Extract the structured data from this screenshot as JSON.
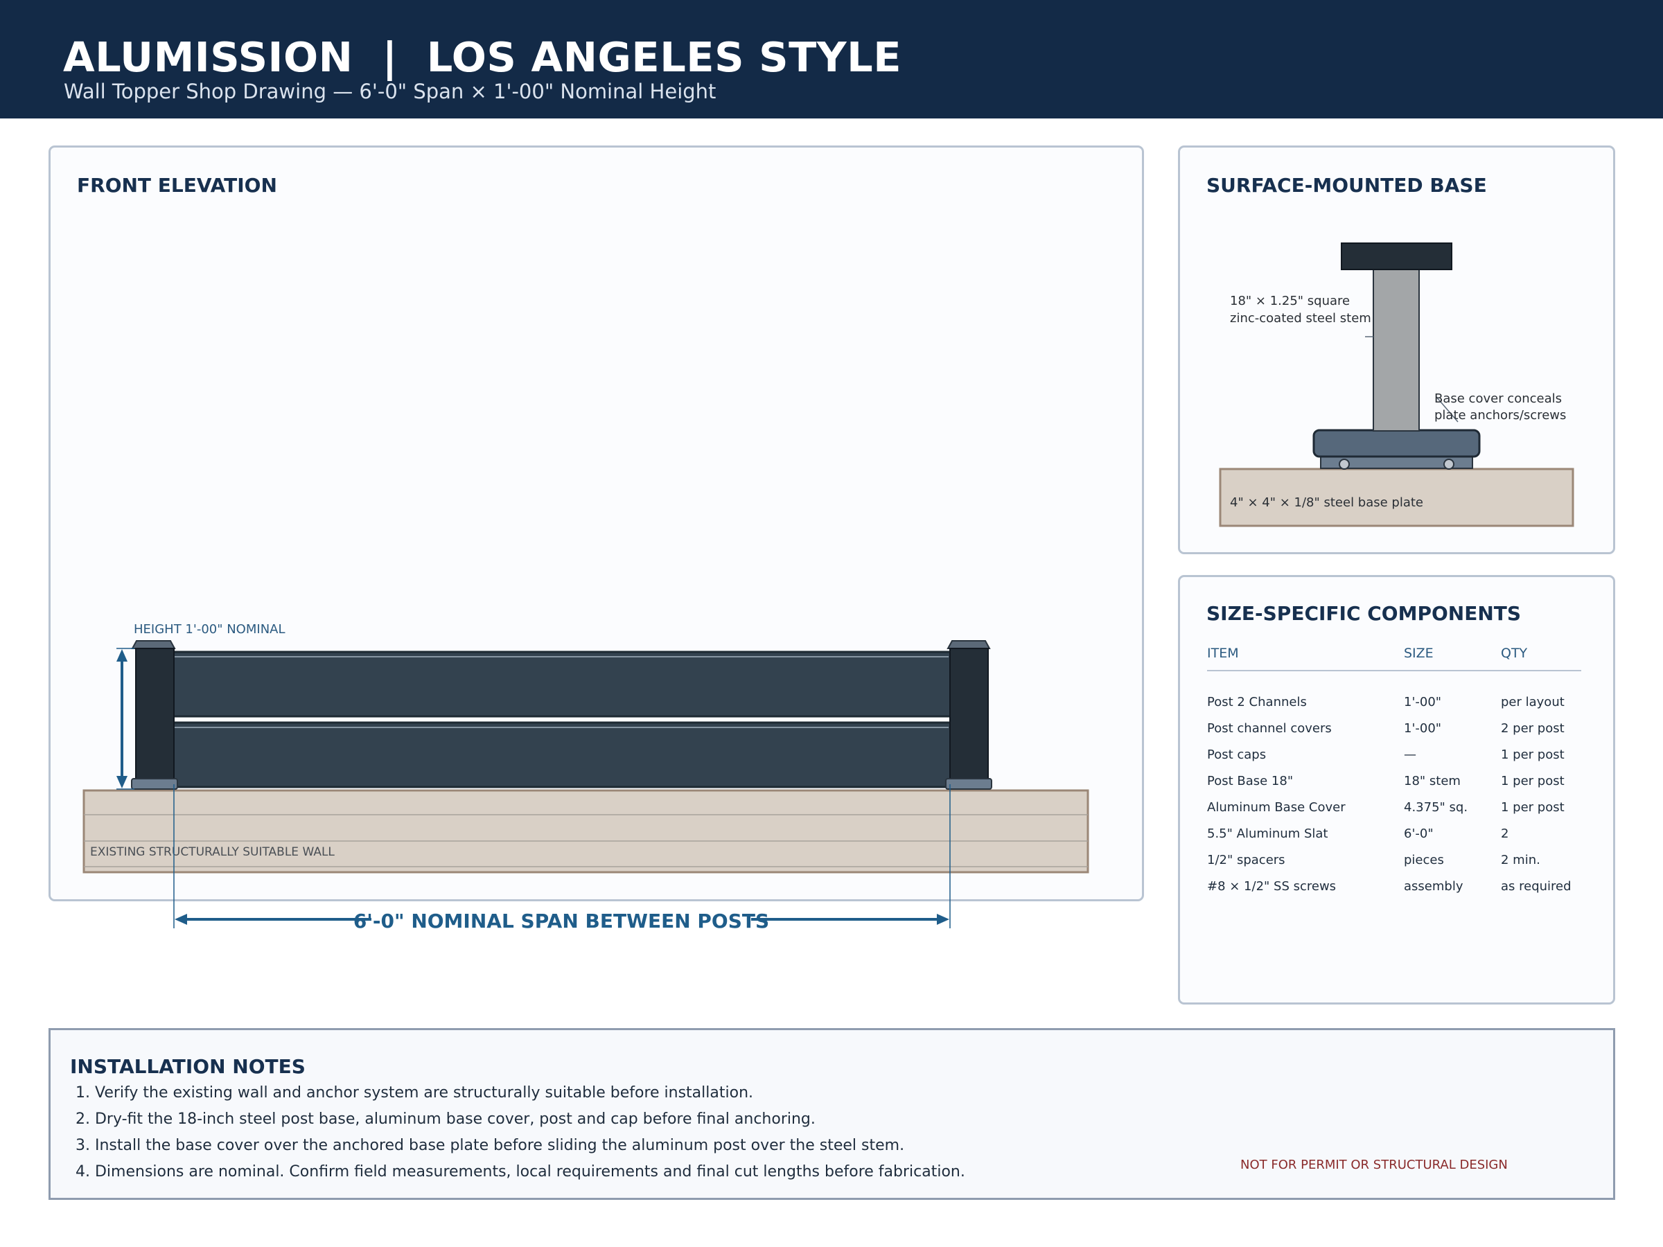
{
  "header": {
    "title": "ALUMISSION  |  LOS ANGELES STYLE",
    "subtitle": "Wall Topper Shop Drawing — 6'-0\" Span × 1'-00\" Nominal Height"
  },
  "elevation": {
    "title": "FRONT ELEVATION",
    "height_label": "HEIGHT 1'-00\" NOMINAL",
    "wall_label": "EXISTING STRUCTURALLY SUITABLE WALL",
    "span_label": "6'-0\" NOMINAL SPAN BETWEEN POSTS"
  },
  "base": {
    "title": "SURFACE-MOUNTED BASE",
    "stem_label_line1": "18\" × 1.25\" square",
    "stem_label_line2": "zinc-coated steel stem",
    "cover_label_line1": "Base cover conceals",
    "cover_label_line2": "plate anchors/screws",
    "plate_label": "4\" × 4\" × 1/8\" steel base plate"
  },
  "components": {
    "title": "SIZE-SPECIFIC COMPONENTS",
    "headers": {
      "item": "ITEM",
      "size": "SIZE",
      "qty": "QTY"
    },
    "rows": [
      {
        "item": "Post 2 Channels",
        "size": "1'-00\"",
        "qty": "per layout"
      },
      {
        "item": "Post channel covers",
        "size": "1'-00\"",
        "qty": "2 per post"
      },
      {
        "item": "Post caps",
        "size": "—",
        "qty": "1 per post"
      },
      {
        "item": "Post Base 18\"",
        "size": "18\" stem",
        "qty": "1 per post"
      },
      {
        "item": "Aluminum Base Cover",
        "size": "4.375\" sq.",
        "qty": "1 per post"
      },
      {
        "item": "5.5\" Aluminum Slat",
        "size": "6'-0\"",
        "qty": "2"
      },
      {
        "item": "1/2\" spacers",
        "size": "pieces",
        "qty": "2 min."
      },
      {
        "item": "#8 × 1/2\" SS screws",
        "size": "assembly",
        "qty": "as required"
      }
    ]
  },
  "notes": {
    "title": "INSTALLATION NOTES",
    "items": [
      "1. Verify the existing wall and anchor system are structurally suitable before installation.",
      "2. Dry-fit the 18-inch steel post base, aluminum base cover, post and cap before final anchoring.",
      "3. Install the base cover over the anchored base plate before sliding the aluminum post over the steel stem.",
      "4. Dimensions are nominal. Confirm field measurements, local requirements and final cut lengths before fabrication."
    ],
    "disclaimer": "NOT FOR PERMIT OR STRUCTURAL DESIGN"
  },
  "colors": {
    "header_bg": "#132a47",
    "slat": "#33424f",
    "post": "#242e37",
    "wall": "#d9d0c6",
    "dimension": "#1f5d8a",
    "steel_stem": "#a3a6a8"
  }
}
